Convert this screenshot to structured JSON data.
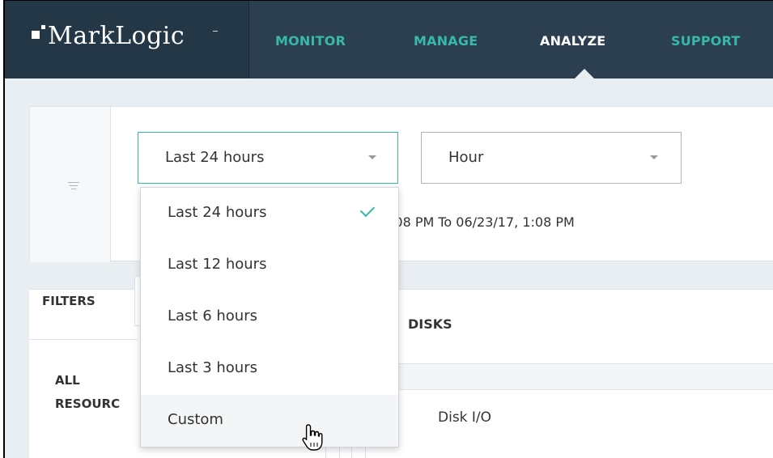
{
  "brand": {
    "name": "MarkLogic"
  },
  "nav": {
    "items": [
      {
        "label": "MONITOR",
        "active": false
      },
      {
        "label": "MANAGE",
        "active": false
      },
      {
        "label": "ANALYZE",
        "active": true
      },
      {
        "label": "SUPPORT",
        "active": false
      }
    ]
  },
  "filters": {
    "period_select": {
      "value": "Last 24 hours"
    },
    "granularity_select": {
      "value": "Hour"
    },
    "range_text": ":08 PM  To 06/23/17, 1:08 PM",
    "period_options": [
      {
        "label": "Last 24 hours",
        "selected": true
      },
      {
        "label": "Last 12 hours",
        "selected": false
      },
      {
        "label": "Last 6 hours",
        "selected": false
      },
      {
        "label": "Last 3 hours",
        "selected": false
      },
      {
        "label": "Custom",
        "selected": false
      }
    ]
  },
  "sidebar": {
    "filters_label": "FILTERS",
    "all_label": "ALL",
    "resources_label": "RESOURC"
  },
  "main": {
    "section_title": "DISKS",
    "row_label": "Disk I/O"
  },
  "icons": {
    "filter": "filter-lines-icon",
    "dropdown_arrow": "triangle-down-icon",
    "check": "checkmark-icon",
    "cursor": "hand-pointer-icon"
  },
  "colors": {
    "nav_bg": "#2b3f50",
    "accent": "#38b8a9",
    "page_bg": "#e9eef2"
  }
}
